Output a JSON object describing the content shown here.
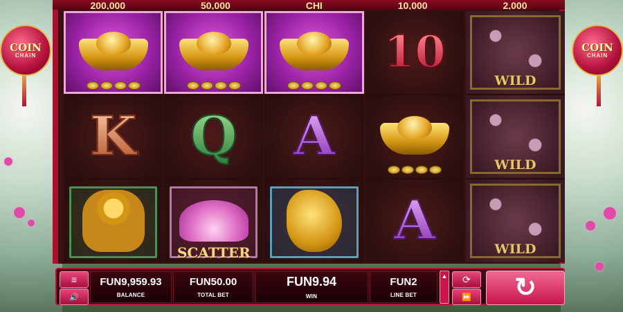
{
  "jackpots": [
    "200,000",
    "50,000",
    "CHI",
    "10,000",
    "2,000"
  ],
  "logo": {
    "line1": "COIN",
    "line2": "CHAIN"
  },
  "reels": [
    [
      {
        "type": "ingot",
        "highlight": true
      },
      {
        "type": "letter",
        "value": "K",
        "style": ""
      },
      {
        "type": "buddha"
      }
    ],
    [
      {
        "type": "ingot",
        "highlight": true
      },
      {
        "type": "letter",
        "value": "Q",
        "style": "green"
      },
      {
        "type": "lotus",
        "label": "SCATTER"
      }
    ],
    [
      {
        "type": "ingot",
        "highlight": true
      },
      {
        "type": "letter",
        "value": "A",
        "style": "purple"
      },
      {
        "type": "koi"
      }
    ],
    [
      {
        "type": "letter",
        "value": "10",
        "style": "red"
      },
      {
        "type": "ingot",
        "highlight": false
      },
      {
        "type": "letter",
        "value": "A",
        "style": "purple"
      }
    ],
    [
      {
        "type": "wild",
        "label": "WILD"
      },
      {
        "type": "wild",
        "label": "WILD"
      },
      {
        "type": "wild",
        "label": "WILD"
      }
    ]
  ],
  "controls": {
    "balance": {
      "value": "FUN9,959.93",
      "label": "BALANCE"
    },
    "total_bet": {
      "value": "FUN50.00",
      "label": "TOTAL BET"
    },
    "win": {
      "value": "FUN9.94",
      "label": "WIN"
    },
    "line_bet": {
      "value": "FUN2",
      "label": "LINE BET"
    },
    "menu_icon": "≡",
    "sound_icon": "🔊",
    "autoplay_icon": "⟳",
    "turbo_icon": "⏩",
    "spin_icon": "↻"
  },
  "colors": {
    "accent": "#c8164d",
    "frame": "#a8102e",
    "gold": "#e7b640"
  }
}
